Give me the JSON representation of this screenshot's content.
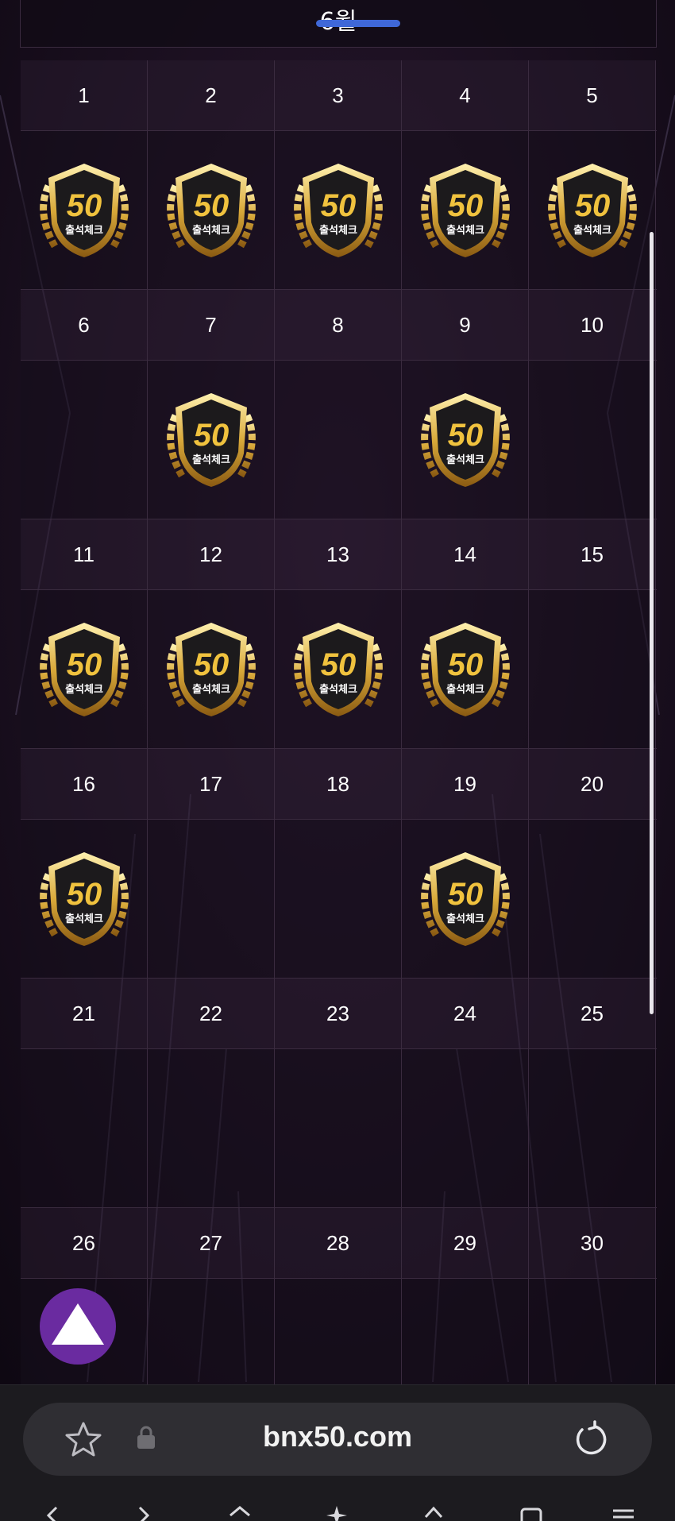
{
  "calendar": {
    "month_label": "6월",
    "badge_text": "출석체크",
    "badge_number": "50",
    "weeks": [
      {
        "days": [
          {
            "day": "1",
            "checked": true
          },
          {
            "day": "2",
            "checked": true
          },
          {
            "day": "3",
            "checked": true
          },
          {
            "day": "4",
            "checked": true
          },
          {
            "day": "5",
            "checked": true
          }
        ]
      },
      {
        "days": [
          {
            "day": "6",
            "checked": false
          },
          {
            "day": "7",
            "checked": true
          },
          {
            "day": "8",
            "checked": false
          },
          {
            "day": "9",
            "checked": true
          },
          {
            "day": "10",
            "checked": false
          }
        ]
      },
      {
        "days": [
          {
            "day": "11",
            "checked": true
          },
          {
            "day": "12",
            "checked": true
          },
          {
            "day": "13",
            "checked": true
          },
          {
            "day": "14",
            "checked": true
          },
          {
            "day": "15",
            "checked": false
          }
        ]
      },
      {
        "days": [
          {
            "day": "16",
            "checked": true
          },
          {
            "day": "17",
            "checked": false
          },
          {
            "day": "18",
            "checked": false
          },
          {
            "day": "19",
            "checked": true
          },
          {
            "day": "20",
            "checked": false
          }
        ]
      },
      {
        "days": [
          {
            "day": "21",
            "checked": false
          },
          {
            "day": "22",
            "checked": false
          },
          {
            "day": "23",
            "checked": false
          },
          {
            "day": "24",
            "checked": false
          },
          {
            "day": "25",
            "checked": false
          }
        ]
      },
      {
        "days": [
          {
            "day": "26",
            "checked": false
          },
          {
            "day": "27",
            "checked": false
          },
          {
            "day": "28",
            "checked": false
          },
          {
            "day": "29",
            "checked": false
          },
          {
            "day": "30",
            "checked": false
          }
        ]
      }
    ]
  },
  "scroll_top_button": {
    "icon": "triangle-up-icon",
    "color": "#6a2ba0"
  },
  "browser": {
    "url": "bnx50.com",
    "bookmark_icon": "star-icon",
    "secure_icon": "lock-icon",
    "reload_icon": "reload-icon",
    "nav_icons": [
      "back-icon",
      "forward-icon",
      "home-icon",
      "ai-sparkle-icon",
      "share-icon",
      "tabs-icon",
      "menu-icon"
    ]
  },
  "colors": {
    "background": "#110a14",
    "month_underline": "#3f68d8",
    "badge_gold": "#d9a93a",
    "fab": "#6a2ba0"
  }
}
